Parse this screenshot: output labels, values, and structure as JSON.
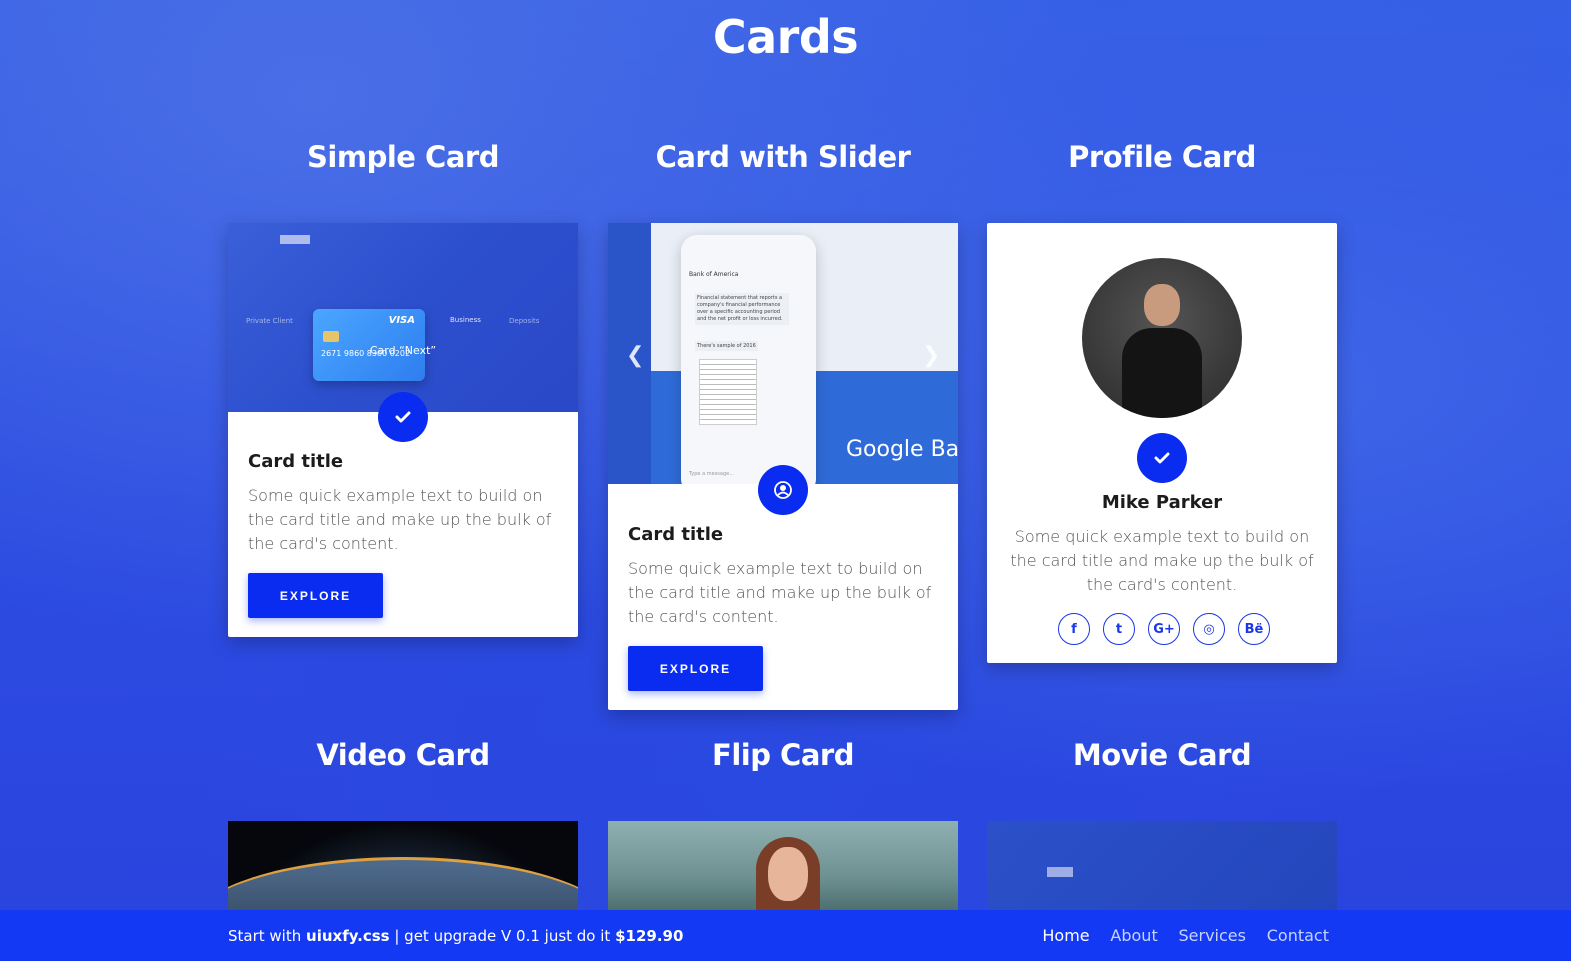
{
  "page": {
    "title": "Cards"
  },
  "sections": {
    "simple": "Simple Card",
    "slider": "Card with Slider",
    "profile": "Profile Card",
    "video": "Video Card",
    "flip": "Flip Card",
    "movie": "Movie Card"
  },
  "simple_card": {
    "image": {
      "brand": "VISA",
      "number": "2671  9860  8300  0202",
      "left_label": "Private Client",
      "mid_label": "Business",
      "right_label": "Deposits",
      "caption": "Card “Next”"
    },
    "title": "Card title",
    "text": "Some quick example text to build on the card title and make up the bulk of the card's content.",
    "button": "EXPLORE"
  },
  "slider_card": {
    "image": {
      "bank_header": "Bank of America",
      "chat_text": "Financial statement that reports a company's financial performance over a specific accounting period and the net profit or loss incurred.",
      "chat_text2": "There's sample of 2016",
      "input_placeholder": "Type a message...",
      "overlay_text": "Google Bar"
    },
    "title": "Card title",
    "text": "Some quick example text to build on the card title and make up the bulk of the card's content.",
    "button": "EXPLORE"
  },
  "profile_card": {
    "name": "Mike Parker",
    "text": "Some quick example text to build on the card title and make up the bulk of the card's content.",
    "social": [
      {
        "icon": "facebook-icon",
        "glyph": "f"
      },
      {
        "icon": "twitter-icon",
        "glyph": "t"
      },
      {
        "icon": "google-plus-icon",
        "glyph": "G+"
      },
      {
        "icon": "dribbble-icon",
        "glyph": "◎"
      },
      {
        "icon": "behance-icon",
        "glyph": "Bë"
      }
    ]
  },
  "footer": {
    "start": "Start with ",
    "brand": "uiuxfy.css",
    "mid": " | get upgrade V 0.1 just do it ",
    "price": "$129.90",
    "nav": [
      "Home",
      "About",
      "Services",
      "Contact"
    ]
  },
  "colors": {
    "accent": "#0a2bf0",
    "footer_bg": "#1339f5",
    "background": "#2d4fe2"
  }
}
